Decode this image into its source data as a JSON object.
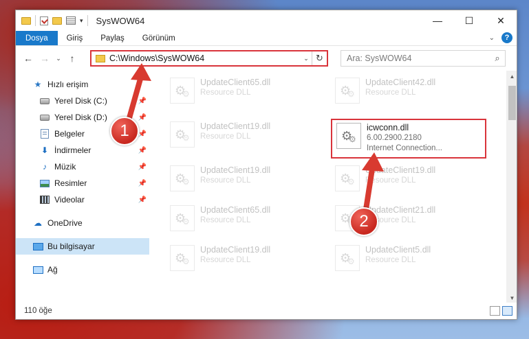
{
  "window": {
    "title": "SysWOW64",
    "controls": {
      "minimize": "—",
      "maximize": "☐",
      "close": "✕"
    }
  },
  "ribbon": {
    "tabs": [
      "Dosya",
      "Giriş",
      "Paylaş",
      "Görünüm"
    ],
    "help": "?"
  },
  "nav": {
    "back": "←",
    "forward": "→",
    "recent": "⌄",
    "up": "↑",
    "address": "C:\\Windows\\SysWOW64",
    "refresh": "↻",
    "search_placeholder": "Ara: SysWOW64"
  },
  "sidebar": {
    "items": [
      {
        "label": "Hızlı erişim",
        "icon": "star-icon"
      },
      {
        "label": "Yerel Disk (C:)",
        "icon": "drive-icon"
      },
      {
        "label": "Yerel Disk (D:)",
        "icon": "drive-icon"
      },
      {
        "label": "Belgeler",
        "icon": "documents-icon"
      },
      {
        "label": "İndirmeler",
        "icon": "downloads-icon"
      },
      {
        "label": "Müzik",
        "icon": "music-icon"
      },
      {
        "label": "Resimler",
        "icon": "pictures-icon"
      },
      {
        "label": "Videolar",
        "icon": "videos-icon"
      },
      {
        "label": "OneDrive",
        "icon": "cloud-icon"
      },
      {
        "label": "Bu bilgisayar",
        "icon": "computer-icon"
      },
      {
        "label": "Ağ",
        "icon": "network-icon"
      }
    ]
  },
  "files": {
    "left_column": [
      {
        "name": "UpdateClient65.dll",
        "type": "Resource DLL"
      },
      {
        "name": "UpdateClient19.dll",
        "type": "Resource DLL"
      },
      {
        "name": "UpdateClient19.dll",
        "type": "Resource DLL"
      },
      {
        "name": "UpdateClient65.dll",
        "type": "Resource DLL"
      },
      {
        "name": "UpdateClient19.dll",
        "type": "Resource DLL"
      }
    ],
    "right_column": [
      {
        "name": "UpdateClient42.dll",
        "type": "Resource DLL"
      },
      {
        "name": "UpdateClient19.dll",
        "type": "Resource DLL"
      },
      {
        "name": "UpdateClient21.dll",
        "type": "Resource DLL"
      },
      {
        "name": "UpdateClient5.dll",
        "type": "Resource DLL"
      }
    ],
    "highlighted": {
      "name": "icwconn.dll",
      "version": "6.00.2900.2180",
      "description": "Internet Connection..."
    }
  },
  "status": {
    "count": "110 öğe"
  },
  "callouts": {
    "first": "1",
    "second": "2"
  },
  "colors": {
    "accent": "#1979ca",
    "highlight_border": "#d9333a",
    "callout": "#c8281f"
  }
}
